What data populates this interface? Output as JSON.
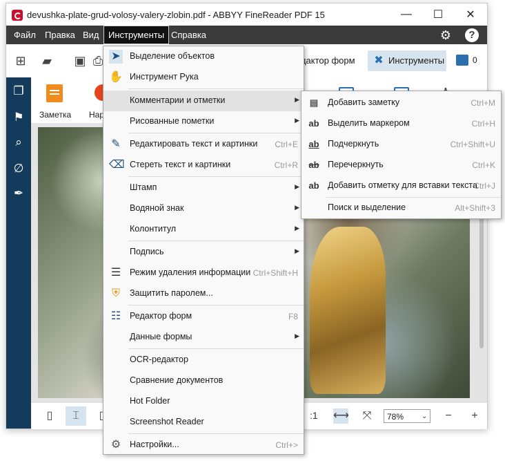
{
  "window": {
    "title": "devushka-plate-grud-volosy-valery-zlobin.pdf - ABBYY FineReader PDF 15",
    "minimize_glyph": "—",
    "maximize_glyph": "☐",
    "close_glyph": "✕"
  },
  "menubar": {
    "items": [
      {
        "label": "Файл"
      },
      {
        "label": "Правка"
      },
      {
        "label": "Вид"
      },
      {
        "label": "Инструменты"
      },
      {
        "label": "Справка"
      }
    ],
    "help_glyph": "?"
  },
  "toolbar": {
    "forms_editor_label": "едактор форм",
    "tools_label": "Инструменты",
    "comments_count": "0"
  },
  "tools_row": {
    "note_label": "Заметка",
    "draw_label": "Нари"
  },
  "tools_menu": {
    "items": [
      {
        "label": "Выделение объектов",
        "shortcut": ""
      },
      {
        "label": "Инструмент Рука",
        "shortcut": ""
      },
      {
        "label": "Комментарии и отметки",
        "shortcut": "",
        "submenu": true
      },
      {
        "label": "Рисованные пометки",
        "shortcut": "",
        "submenu": true
      },
      {
        "label": "Редактировать текст и картинки",
        "shortcut": "Ctrl+E"
      },
      {
        "label": "Стереть текст и картинки",
        "shortcut": "Ctrl+R"
      },
      {
        "label": "Штамп",
        "shortcut": "",
        "submenu": true
      },
      {
        "label": "Водяной знак",
        "shortcut": "",
        "submenu": true
      },
      {
        "label": "Колонтитул",
        "shortcut": "",
        "submenu": true
      },
      {
        "label": "Подпись",
        "shortcut": "",
        "submenu": true
      },
      {
        "label": "Режим удаления информации",
        "shortcut": "Ctrl+Shift+H"
      },
      {
        "label": "Защитить паролем...",
        "shortcut": ""
      },
      {
        "label": "Редактор форм",
        "shortcut": "F8"
      },
      {
        "label": "Данные формы",
        "shortcut": "",
        "submenu": true
      },
      {
        "label": "OCR-редактор",
        "shortcut": ""
      },
      {
        "label": "Сравнение документов",
        "shortcut": ""
      },
      {
        "label": "Hot Folder",
        "shortcut": ""
      },
      {
        "label": "Screenshot Reader",
        "shortcut": ""
      },
      {
        "label": "Настройки...",
        "shortcut": "Ctrl+>"
      }
    ]
  },
  "comments_submenu": {
    "items": [
      {
        "label": "Добавить заметку",
        "shortcut": "Ctrl+M"
      },
      {
        "label": "Выделить маркером",
        "shortcut": "Ctrl+H"
      },
      {
        "label": "Подчеркнуть",
        "shortcut": "Ctrl+Shift+U"
      },
      {
        "label": "Перечеркнуть",
        "shortcut": "Ctrl+K"
      },
      {
        "label": "Добавить отметку для вставки текста",
        "shortcut": "Ctrl+J"
      },
      {
        "label": "Поиск и выделение",
        "shortcut": "Alt+Shift+3"
      }
    ]
  },
  "statusbar": {
    "zoom_value": "78%",
    "page_fit_label": ":1"
  },
  "colors": {
    "menubar_bg": "#3b3b3b",
    "sidebar_bg": "#143a5c",
    "accent_blue": "#2a6fb0",
    "selected_tool_bg": "#d6e4f0"
  }
}
